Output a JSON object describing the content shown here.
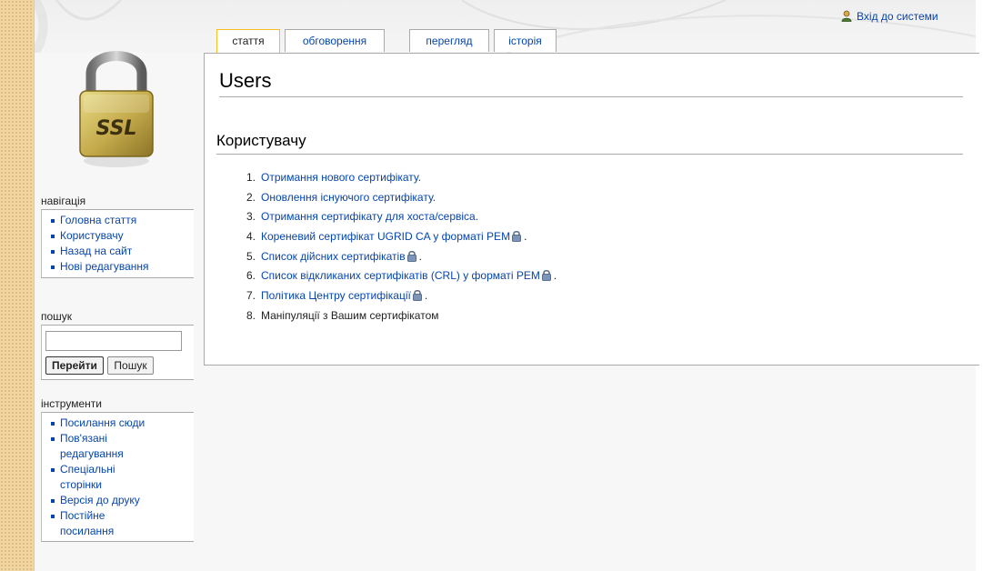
{
  "personal": {
    "login": "Вхід до системи"
  },
  "tabs": [
    {
      "label": "стаття"
    },
    {
      "label": "обговорення"
    },
    {
      "label": "перегляд"
    },
    {
      "label": "історія"
    }
  ],
  "logo": {
    "text": "SSL"
  },
  "page": {
    "title": "Users",
    "section_heading": "Користувачу",
    "items": [
      {
        "num": "1.",
        "label": "Отримання нового сертифікату."
      },
      {
        "num": "2.",
        "label": "Оновлення існуючого сертифікату."
      },
      {
        "num": "3.",
        "label": "Отримання сертифікату для хоста/сервіса."
      },
      {
        "num": "4.",
        "label": "Кореневий сертифікат UGRID CA у форматі PEM",
        "suffix": "."
      },
      {
        "num": "5.",
        "label": "Список дійсних сертифікатів",
        "suffix": "."
      },
      {
        "num": "6.",
        "label": "Список відкликаних сертифікатів (CRL) у форматі PEM",
        "suffix": "."
      },
      {
        "num": "7.",
        "label": "Політика Центру сертифікації",
        "suffix": "."
      },
      {
        "num": "8.",
        "label": "Маніпуляції з Вашим сертифікатом"
      }
    ]
  },
  "sidebar": {
    "navigation": {
      "title": "навігація",
      "items": [
        {
          "label": "Головна стаття"
        },
        {
          "label": "Користувачу"
        },
        {
          "label": "Назад на сайт"
        },
        {
          "label": "Нові редагування"
        }
      ]
    },
    "search": {
      "title": "пошук",
      "go_button": "Перейти",
      "search_button": "Пошук"
    },
    "tools": {
      "title": "інструменти",
      "items": [
        {
          "label": "Посилання сюди"
        },
        {
          "label": "Пов'язані редагування"
        },
        {
          "label": "Спеціальні сторінки"
        },
        {
          "label": "Версія до друку"
        },
        {
          "label": "Постійне посилання"
        }
      ]
    }
  },
  "colors": {
    "link": "#0645ad",
    "tab_selected_border": "#fabd23",
    "border": "#aaaaaa",
    "left_strip": "#f3d7a2"
  },
  "icons": {
    "user": "user-icon",
    "lock": "lock-icon",
    "logo": "padlock-logo"
  }
}
